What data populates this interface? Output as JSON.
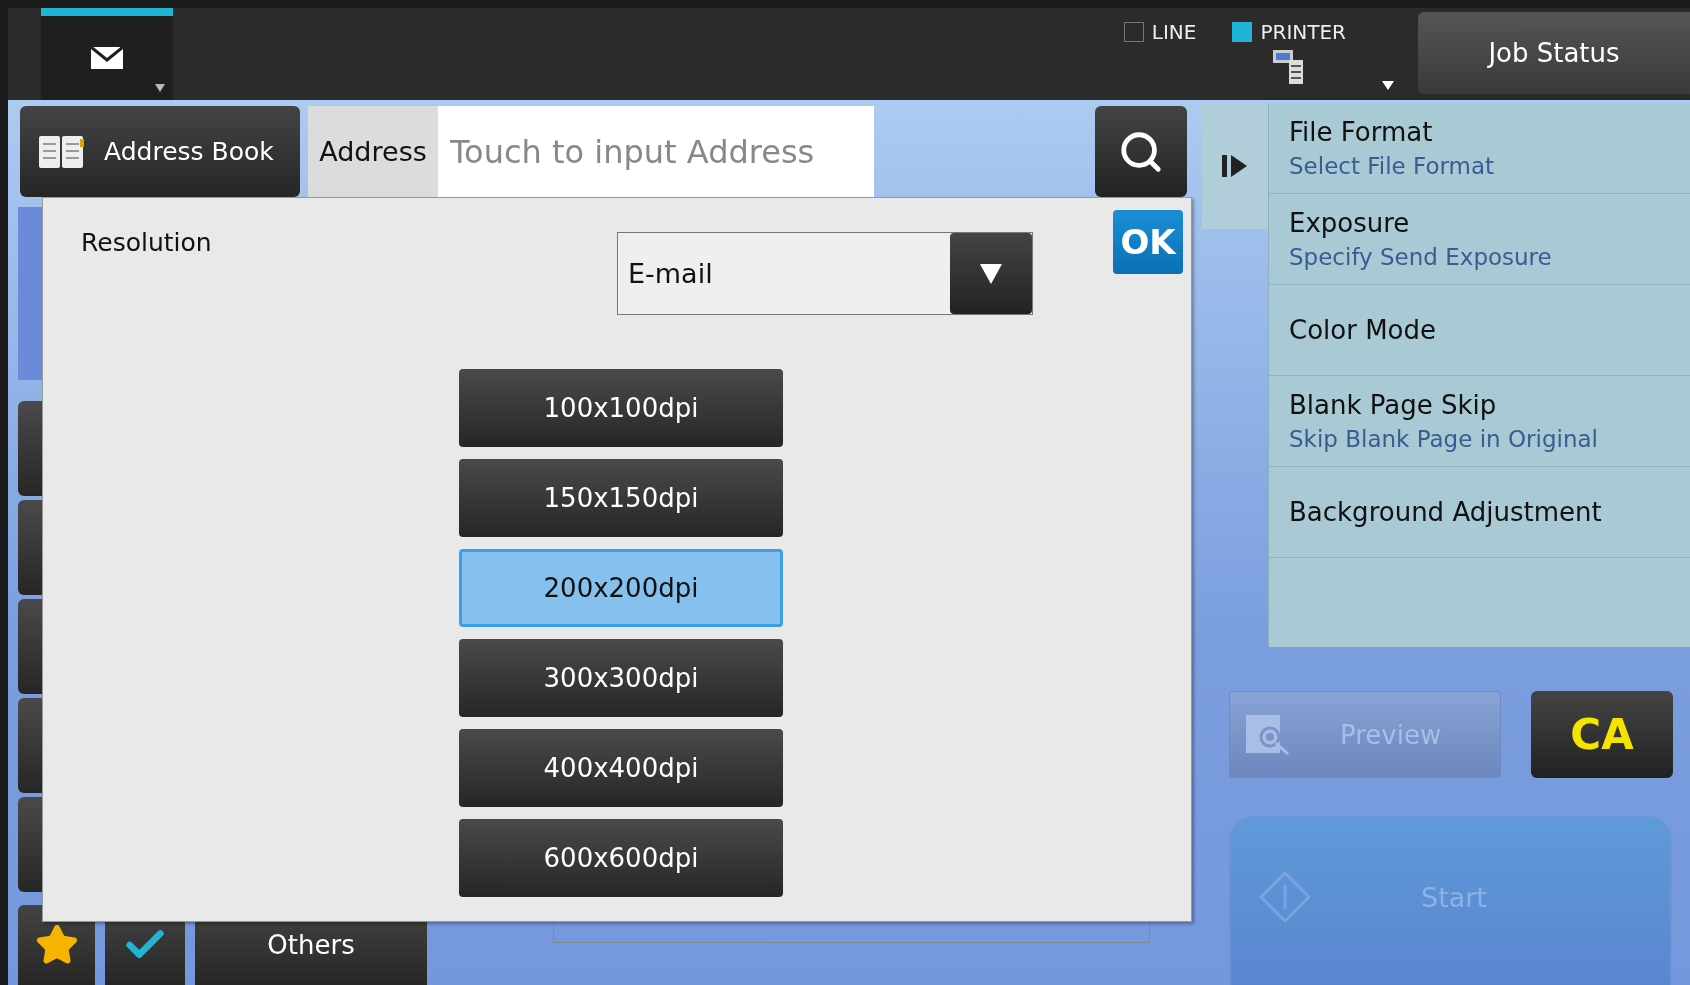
{
  "top_bar": {
    "mode_tab": {
      "selected": true
    },
    "indicators": [
      {
        "label": "LINE",
        "on": false
      },
      {
        "label": "PRINTER",
        "on": true
      }
    ],
    "job_status": "Job Status"
  },
  "address_bar": {
    "address_book": "Address Book",
    "address_label": "Address",
    "address_placeholder": "Touch to input Address"
  },
  "dialog": {
    "title": "Resolution",
    "mode_select": "E-mail",
    "ok": "OK",
    "options": [
      {
        "label": "100x100dpi",
        "selected": false
      },
      {
        "label": "150x150dpi",
        "selected": false
      },
      {
        "label": "200x200dpi",
        "selected": true
      },
      {
        "label": "300x300dpi",
        "selected": false
      },
      {
        "label": "400x400dpi",
        "selected": false
      },
      {
        "label": "600x600dpi",
        "selected": false
      }
    ]
  },
  "bottom_tabs": [
    {
      "kind": "star"
    },
    {
      "kind": "check"
    },
    {
      "kind": "text",
      "label": "Others"
    }
  ],
  "settings": [
    {
      "title": "File Format",
      "subtitle": "Select File Format"
    },
    {
      "title": "Exposure",
      "subtitle": "Specify Send Exposure"
    },
    {
      "title": "Color Mode"
    },
    {
      "title": "Blank Page Skip",
      "subtitle": "Skip Blank Page in Original"
    },
    {
      "title": "Background Adjustment"
    }
  ],
  "preview": {
    "label": "Preview",
    "disabled": true
  },
  "clear_all": "CA",
  "start": {
    "label": "Start",
    "disabled": true
  }
}
